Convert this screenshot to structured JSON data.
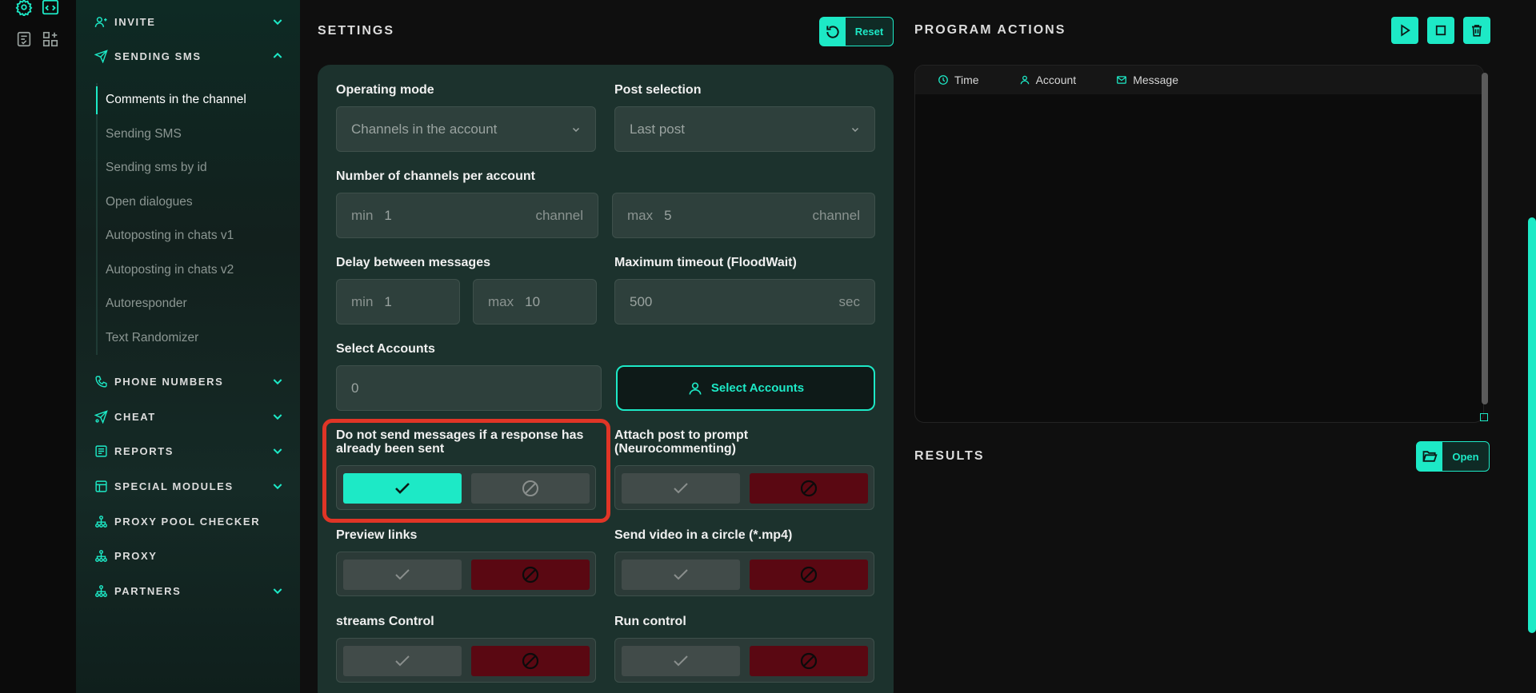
{
  "rail": {
    "icons": [
      "settings-icon",
      "code-icon",
      "checklist-icon",
      "apps-icon"
    ]
  },
  "sidebar": {
    "sections": [
      {
        "label": "INVITE",
        "icon": "users-icon",
        "expanded": false
      },
      {
        "label": "SENDING SMS",
        "icon": "send-icon",
        "expanded": true
      },
      {
        "label": "PHONE NUMBERS",
        "icon": "phone-icon",
        "expanded": false
      },
      {
        "label": "CHEAT",
        "icon": "send-icon",
        "expanded": false
      },
      {
        "label": "REPORTS",
        "icon": "report-icon",
        "expanded": false
      },
      {
        "label": "SPECIAL MODULES",
        "icon": "modules-icon",
        "expanded": false
      },
      {
        "label": "PROXY POOL CHECKER",
        "icon": "network-icon",
        "expanded": false
      },
      {
        "label": "PROXY",
        "icon": "network-icon",
        "expanded": false
      },
      {
        "label": "PARTNERS",
        "icon": "network-icon",
        "expanded": false
      }
    ],
    "sending_sms_items": [
      "Comments in the channel",
      "Sending SMS",
      "Sending sms by id",
      "Open dialogues",
      "Autoposting in chats v1",
      "Autoposting in chats v2",
      "Autoresponder",
      "Text Randomizer"
    ],
    "active_item": "Comments in the channel"
  },
  "settings": {
    "title": "SETTINGS",
    "reset_label": "Reset",
    "operating_mode": {
      "label": "Operating mode",
      "value": "Channels in the account"
    },
    "post_selection": {
      "label": "Post selection",
      "value": "Last post"
    },
    "channels_per_account": {
      "label": "Number of channels per account",
      "min_prefix": "min",
      "min_value": "1",
      "min_suffix": "channel",
      "max_prefix": "max",
      "max_value": "5",
      "max_suffix": "channel"
    },
    "delay": {
      "label": "Delay between messages",
      "min_prefix": "min",
      "min_value": "1",
      "max_prefix": "max",
      "max_value": "10"
    },
    "timeout": {
      "label": "Maximum timeout (FloodWait)",
      "value": "500",
      "suffix": "sec"
    },
    "select_accounts": {
      "label": "Select Accounts",
      "value": "0",
      "button_label": "Select Accounts"
    },
    "toggles": [
      {
        "label_line1": "Do not send messages if a response has",
        "label_line2": "already been sent",
        "state": "yes"
      },
      {
        "label_line1": "Attach post to prompt",
        "label_line2": "(Neurocommenting)",
        "state": "no"
      },
      {
        "label_line1": "Preview links",
        "label_line2": "",
        "state": "no"
      },
      {
        "label_line1": "Send video in a circle (*.mp4)",
        "label_line2": "",
        "state": "no"
      },
      {
        "label_line1": "streams Control",
        "label_line2": "",
        "state": "no"
      },
      {
        "label_line1": "Run control",
        "label_line2": "",
        "state": "no"
      }
    ]
  },
  "program_actions": {
    "title": "PROGRAM ACTIONS",
    "columns": [
      "Time",
      "Account",
      "Message"
    ],
    "buttons": [
      "play-icon",
      "stop-icon",
      "trash-icon"
    ]
  },
  "results": {
    "title": "RESULTS",
    "open_label": "Open"
  },
  "colors": {
    "accent": "#1de9c6",
    "danger": "#5a0812",
    "highlight": "#e03526"
  }
}
